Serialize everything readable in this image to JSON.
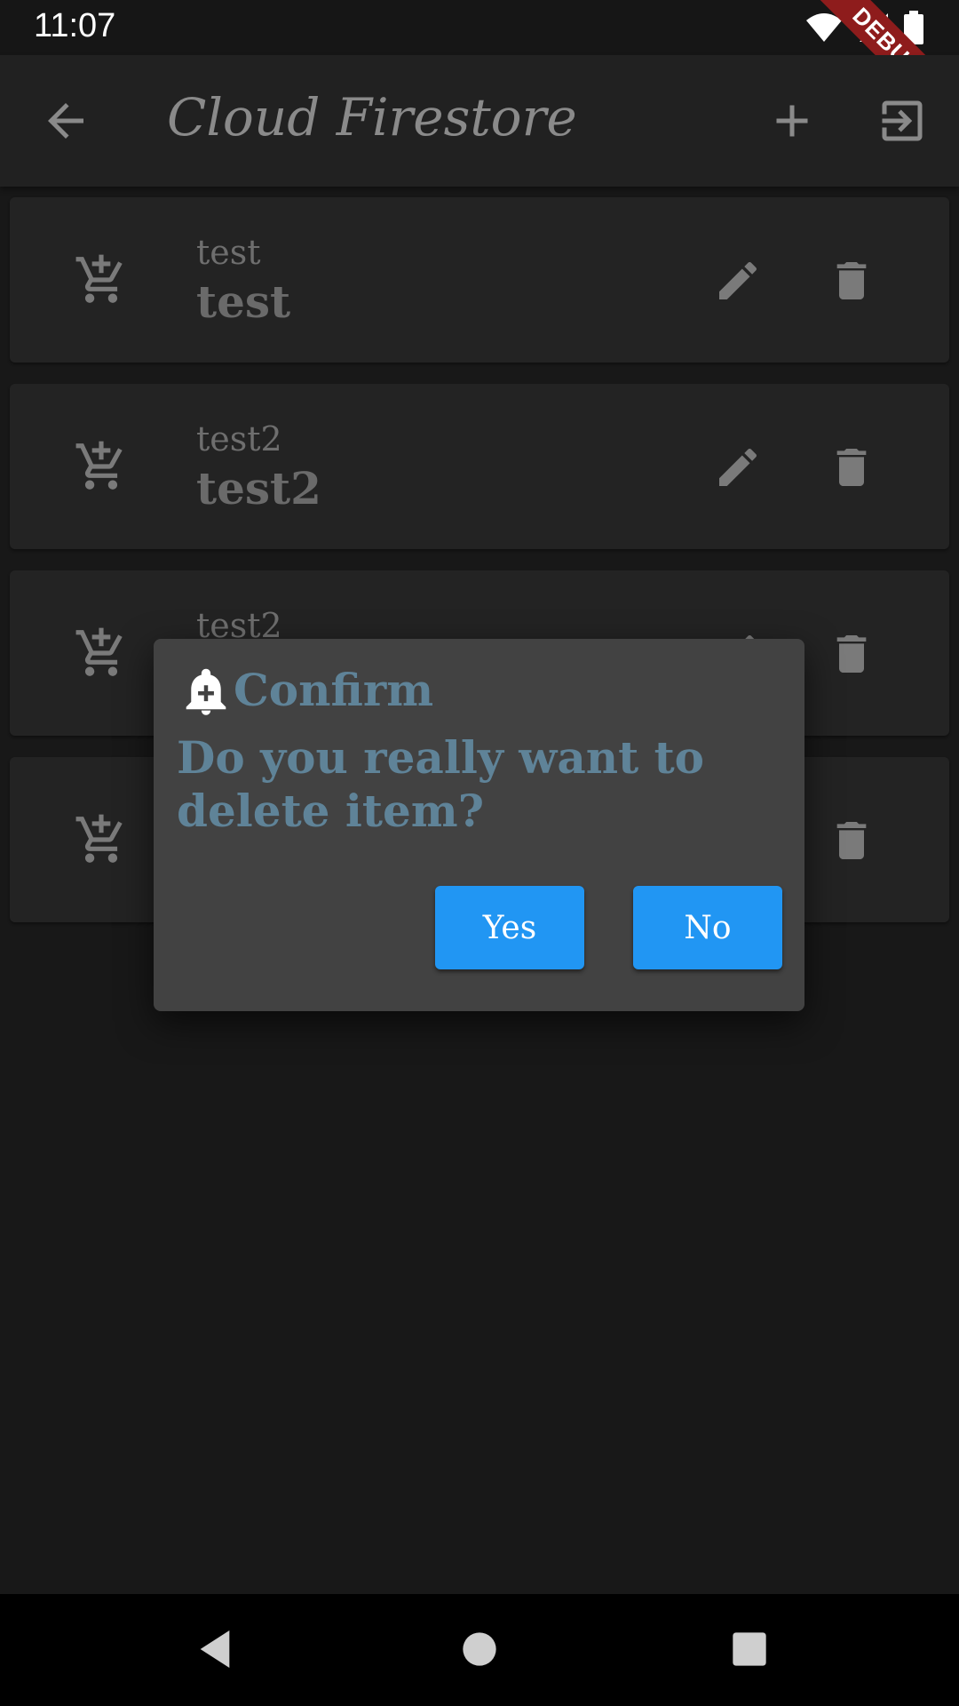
{
  "status_bar": {
    "time": "11:07",
    "debug_label": "DEBUG"
  },
  "app_bar": {
    "title": "Cloud Firestore",
    "icons": [
      "arrow-back-icon",
      "add-icon",
      "logout-icon"
    ]
  },
  "items": [
    {
      "subtitle": "test",
      "title": "test"
    },
    {
      "subtitle": "test2",
      "title": "test2"
    },
    {
      "subtitle": "test2",
      "title": ""
    },
    {
      "subtitle": "",
      "title": ""
    }
  ],
  "dialog": {
    "title": "Confirm",
    "message": "Do you really want to delete item?",
    "yes_label": "Yes",
    "no_label": "No",
    "icon": "bell-plus-icon"
  },
  "nav_bar": {
    "icons": [
      "nav-back-icon",
      "nav-home-icon",
      "nav-recents-icon"
    ]
  },
  "colors": {
    "accent": "#2196f3",
    "dialog_text": "#5f8398",
    "background": "#181818",
    "debug_banner": "#8e1c1c"
  }
}
